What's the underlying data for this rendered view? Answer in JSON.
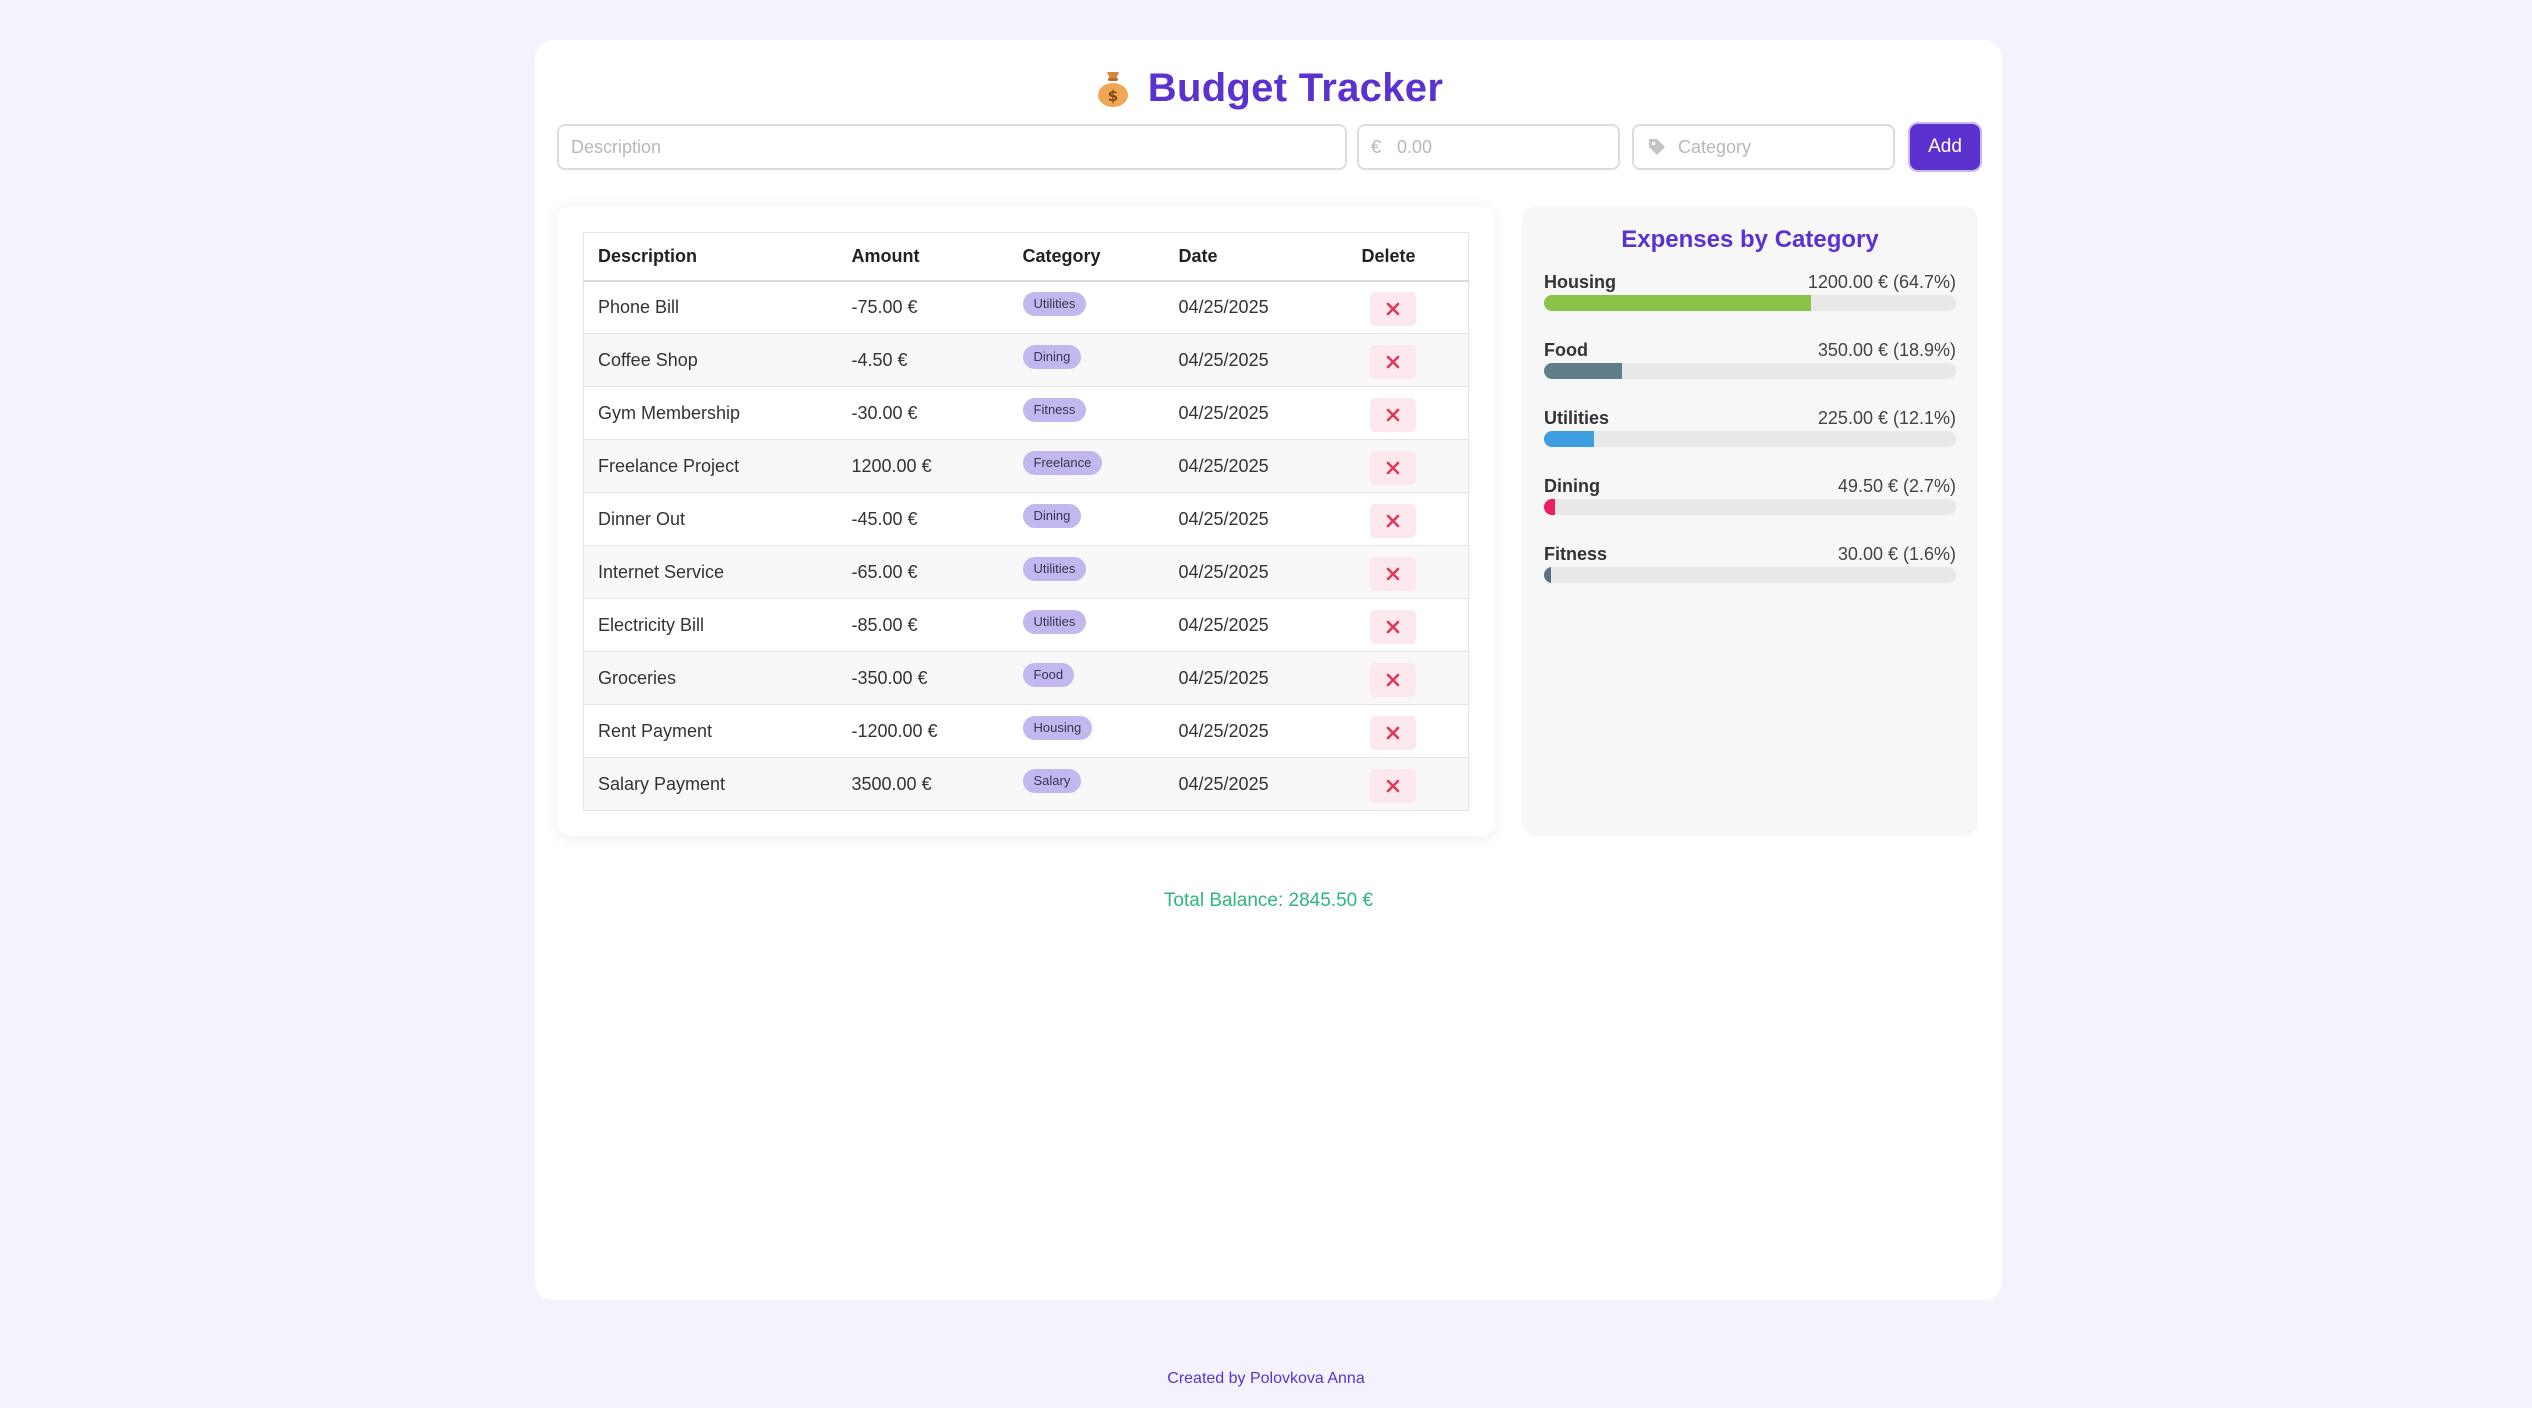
{
  "app": {
    "title": "Budget Tracker",
    "icon": "money-bag-icon"
  },
  "form": {
    "description_placeholder": "Description",
    "amount_placeholder": "0.00",
    "currency_symbol": "€",
    "category_placeholder": "Category",
    "add_label": "Add"
  },
  "table": {
    "headers": [
      "Description",
      "Amount",
      "Category",
      "Date",
      "Delete"
    ],
    "rows": [
      {
        "description": "Phone Bill",
        "amount": "-75.00 €",
        "type": "expense",
        "category": "Utilities",
        "date": "04/25/2025"
      },
      {
        "description": "Coffee Shop",
        "amount": "-4.50 €",
        "type": "expense",
        "category": "Dining",
        "date": "04/25/2025"
      },
      {
        "description": "Gym Membership",
        "amount": "-30.00 €",
        "type": "expense",
        "category": "Fitness",
        "date": "04/25/2025"
      },
      {
        "description": "Freelance Project",
        "amount": "1200.00 €",
        "type": "income",
        "category": "Freelance",
        "date": "04/25/2025"
      },
      {
        "description": "Dinner Out",
        "amount": "-45.00 €",
        "type": "expense",
        "category": "Dining",
        "date": "04/25/2025"
      },
      {
        "description": "Internet Service",
        "amount": "-65.00 €",
        "type": "expense",
        "category": "Utilities",
        "date": "04/25/2025"
      },
      {
        "description": "Electricity Bill",
        "amount": "-85.00 €",
        "type": "expense",
        "category": "Utilities",
        "date": "04/25/2025"
      },
      {
        "description": "Groceries",
        "amount": "-350.00 €",
        "type": "expense",
        "category": "Food",
        "date": "04/25/2025"
      },
      {
        "description": "Rent Payment",
        "amount": "-1200.00 €",
        "type": "expense",
        "category": "Housing",
        "date": "04/25/2025"
      },
      {
        "description": "Salary Payment",
        "amount": "3500.00 €",
        "type": "income",
        "category": "Salary",
        "date": "04/25/2025"
      }
    ]
  },
  "expenses": {
    "title": "Expenses by Category",
    "items": [
      {
        "name": "Housing",
        "value": "1200.00 € (64.7%)",
        "percent": 64.7,
        "color": "#8bc34a"
      },
      {
        "name": "Food",
        "value": "350.00 € (18.9%)",
        "percent": 18.9,
        "color": "#607d8b"
      },
      {
        "name": "Utilities",
        "value": "225.00 € (12.1%)",
        "percent": 12.1,
        "color": "#3e9de0"
      },
      {
        "name": "Dining",
        "value": "49.50 € (2.7%)",
        "percent": 2.7,
        "color": "#e91e63"
      },
      {
        "name": "Fitness",
        "value": "30.00 € (1.6%)",
        "percent": 1.6,
        "color": "#5a7184"
      }
    ]
  },
  "total": {
    "label": "Total Balance: 2845.50 €"
  },
  "footer": {
    "credit": "Created by Polovkova Anna"
  },
  "colors": {
    "accent": "#5b32d0",
    "negative": "#e0385b",
    "positive": "#2fb67b"
  }
}
